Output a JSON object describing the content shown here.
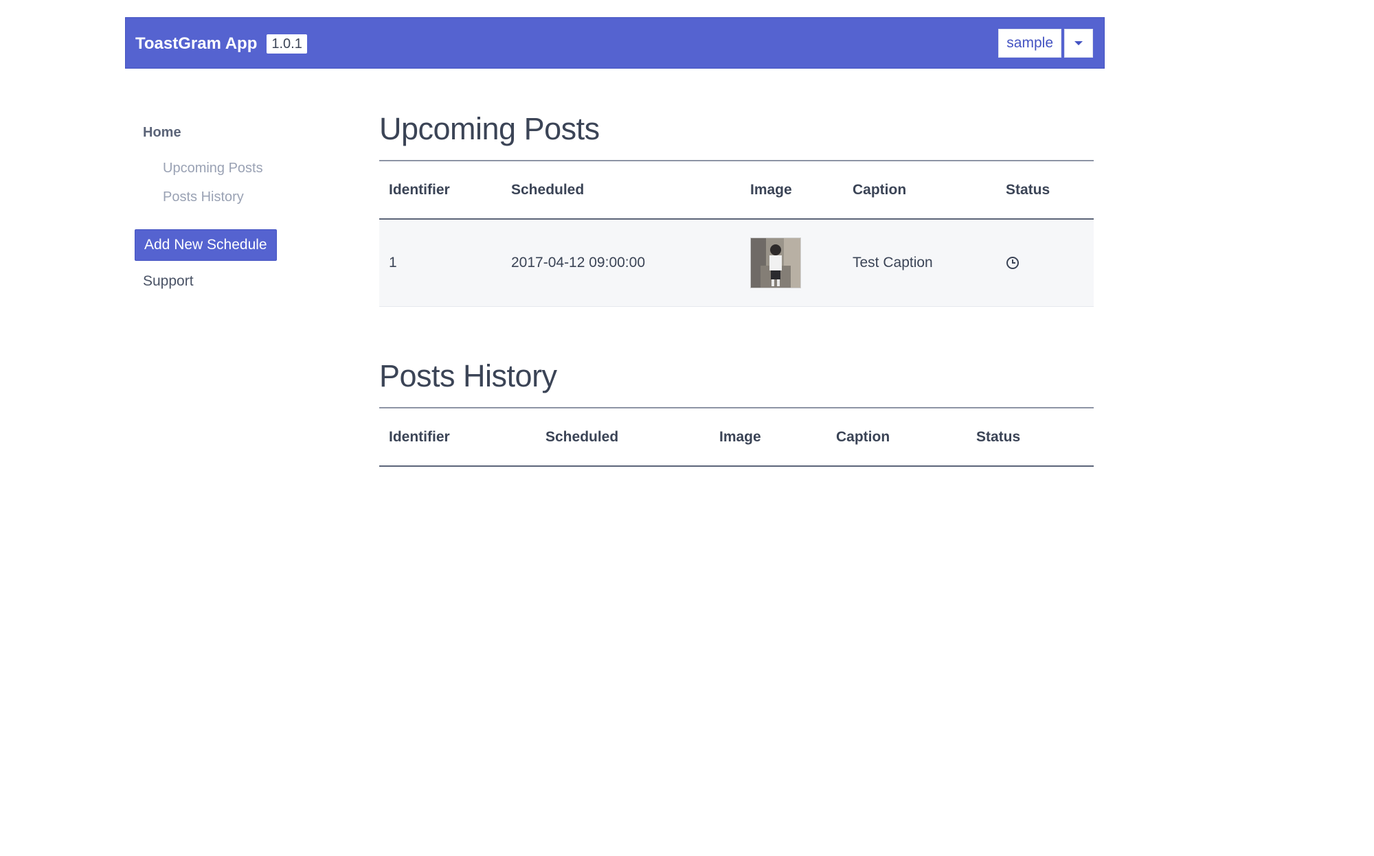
{
  "header": {
    "title": "ToastGram App",
    "version": "1.0.1",
    "user_label": "sample",
    "dropdown_icon": "caret-down-icon",
    "colors": {
      "bar": "#5563d0",
      "accent": "#4453c2"
    }
  },
  "sidebar": {
    "home": "Home",
    "upcoming": "Upcoming Posts",
    "history": "Posts History",
    "add_button": "Add New Schedule",
    "support": "Support"
  },
  "upcoming": {
    "title": "Upcoming Posts",
    "columns": [
      "Identifier",
      "Scheduled",
      "Image",
      "Caption",
      "Status"
    ],
    "rows": [
      {
        "identifier": "1",
        "scheduled": "2017-04-12 09:00:00",
        "image": "post-thumbnail",
        "caption": "Test Caption",
        "status_icon": "clock-icon"
      }
    ]
  },
  "history": {
    "title": "Posts History",
    "columns": [
      "Identifier",
      "Scheduled",
      "Image",
      "Caption",
      "Status"
    ],
    "rows": []
  }
}
